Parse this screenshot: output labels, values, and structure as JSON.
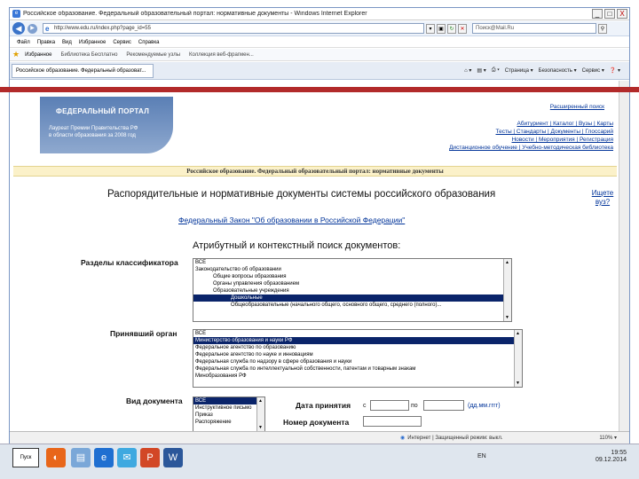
{
  "window": {
    "title": "Российское образование. Федеральный образовательный портал: нормативные документы - Windows Internet Explorer",
    "min": "_",
    "max": "□",
    "close": "X"
  },
  "address": {
    "url": "http://www.edu.ru/index.php?page_id=55",
    "search_placeholder": "Поиск@Mail.Ru"
  },
  "menu": [
    "Файл",
    "Правка",
    "Вид",
    "Избранное",
    "Сервис",
    "Справка"
  ],
  "favorites": {
    "label": "Избранное",
    "items": [
      "Библиотека Бесплатно",
      "Рекомендуемые узлы",
      "Коллекция веб-фрагмен..."
    ]
  },
  "tab": {
    "label": "Российское образование. Федеральный образоват..."
  },
  "commands": [
    "Страница ▾",
    "Безопасность ▾",
    "Сервис ▾",
    "❓ ▾"
  ],
  "portal": {
    "logo_title": "ФЕДЕРАЛЬНЫЙ ПОРТАЛ",
    "logo_sub1": "Лауреат Премии Правительства РФ",
    "logo_sub2": "в области образования за 2008 год",
    "top_link": "Расширенный поиск",
    "links_row1": "Абитуриент | Каталог | Вузы | Карты",
    "links_row2": "Тесты | Стандарты | Документы | Глоссарий",
    "links_row3": "Новости | Мероприятия | Регистрация",
    "links_row4": "Дистанционное обучение | Учебно-методическая библиотека",
    "banner": "Российское образование. Федеральный образовательный портал: нормативные документы"
  },
  "page": {
    "title": "Распорядительные и нормативные документы системы российского образования",
    "help": "Ищете вуз?",
    "law_link": "Федеральный Закон \"Об образовании в Российской Федерации\"",
    "search_title": "Атрибутный и контекстный поиск документов:"
  },
  "form": {
    "classifier_label": "Разделы классификатора",
    "classifier_items": [
      "ВСЕ",
      "Законодательство об образовании",
      "Общие вопросы образования",
      "Органы управления образованием",
      "Образовательные учреждения",
      "Дошкольные",
      "Общеобразовательные (начального общего, основного общего, среднего (полного)..."
    ],
    "classifier_selected": 5,
    "org_label": "Принявший орган",
    "org_items": [
      "ВСЕ",
      "Министерство образования и науки РФ",
      "Федеральное агентство по образованию",
      "Федеральное агентство по науке и инновациям",
      "Федеральная служба по надзору в сфере образования и науки",
      "Федеральная служба по интеллектуальной собственности, патентам и товарным знакам",
      "Минобразования РФ"
    ],
    "org_selected": 1,
    "doctype_label": "Вид документа",
    "doctype_items": [
      "ВСЕ",
      "Инструктивное письмо",
      "Приказ",
      "Распоряжение"
    ],
    "doctype_selected": 0,
    "date_label": "Дата принятия",
    "date_from": "с",
    "date_to": "по",
    "date_format": "(дд.мм.гггг)",
    "docnum_label": "Номер документа"
  },
  "status": {
    "zone": "Интернет | Защищенный режим: выкл.",
    "zoom": "110% ▾"
  },
  "taskbar": {
    "start": "Пуск",
    "lang": "EN",
    "time": "19:55",
    "date": "09.12.2014"
  }
}
